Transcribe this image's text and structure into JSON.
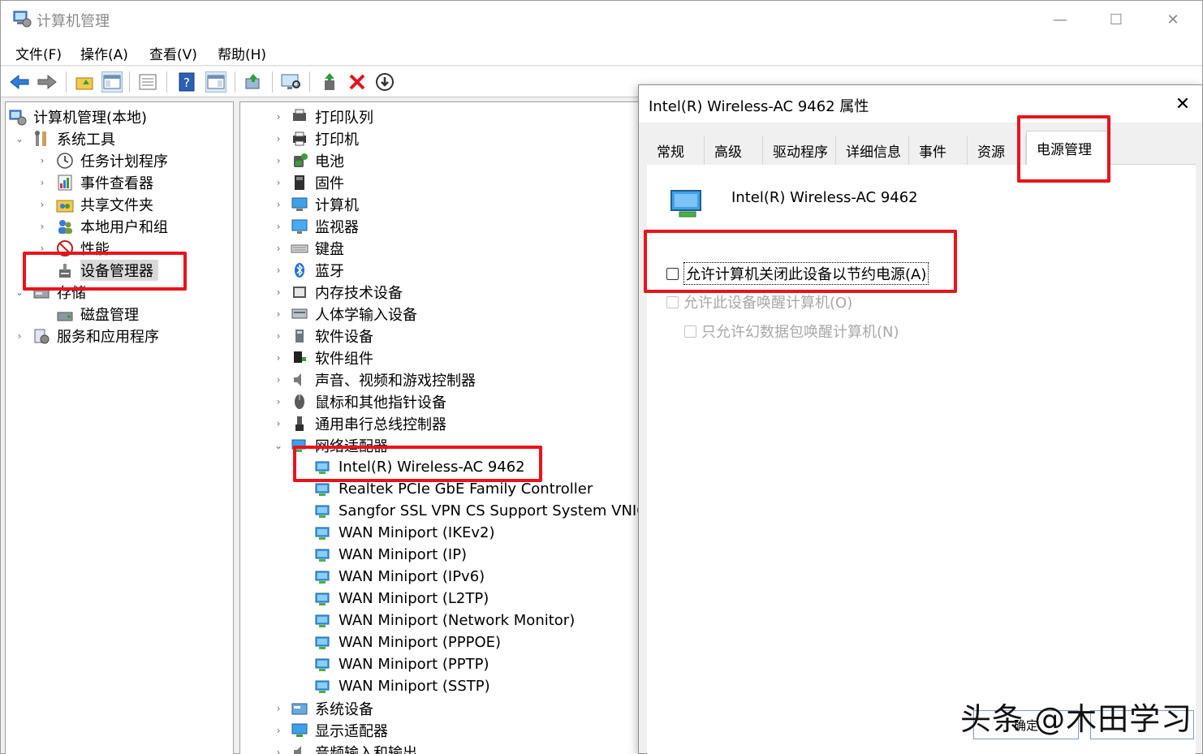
{
  "window": {
    "title": "计算机管理",
    "menu": [
      "文件(F)",
      "操作(A)",
      "查看(V)",
      "帮助(H)"
    ]
  },
  "left_tree": {
    "root": "计算机管理(本地)",
    "system_tools": "系统工具",
    "items": [
      "任务计划程序",
      "事件查看器",
      "共享文件夹",
      "本地用户和组",
      "性能",
      "设备管理器"
    ],
    "storage": "存储",
    "disk_mgmt": "磁盘管理",
    "services": "服务和应用程序"
  },
  "device_tree": {
    "categories_before": [
      "打印队列",
      "打印机",
      "电池",
      "固件",
      "计算机",
      "监视器",
      "键盘",
      "蓝牙",
      "内存技术设备",
      "人体学输入设备",
      "软件设备",
      "软件组件",
      "声音、视频和游戏控制器",
      "鼠标和其他指针设备",
      "通用串行总线控制器"
    ],
    "network_adapters": "网络适配器",
    "adapters": [
      "Intel(R) Wireless-AC 9462",
      "Realtek PCIe GbE Family Controller",
      "Sangfor SSL VPN CS Support System VNIC",
      "WAN Miniport (IKEv2)",
      "WAN Miniport (IP)",
      "WAN Miniport (IPv6)",
      "WAN Miniport (L2TP)",
      "WAN Miniport (Network Monitor)",
      "WAN Miniport (PPPOE)",
      "WAN Miniport (PPTP)",
      "WAN Miniport (SSTP)"
    ],
    "categories_after": [
      "系统设备",
      "显示适配器",
      "音频输入和输出"
    ]
  },
  "dialog": {
    "title": "Intel(R) Wireless-AC 9462 属性",
    "tabs": [
      "常规",
      "高级",
      "驱动程序",
      "详细信息",
      "事件",
      "资源",
      "电源管理"
    ],
    "active_tab": "电源管理",
    "device_name": "Intel(R) Wireless-AC 9462",
    "options": [
      {
        "label": "允许计算机关闭此设备以节约电源(A)",
        "checked": false,
        "enabled": true
      },
      {
        "label": "允许此设备唤醒计算机(O)",
        "checked": false,
        "enabled": false
      },
      {
        "label": "只允许幻数据包唤醒计算机(N)",
        "checked": false,
        "enabled": false
      }
    ],
    "ok_label": "确定"
  },
  "watermark": "头条 @木田学习",
  "colors": {
    "highlight": "#e8141b",
    "selection": "#d9d9d9"
  }
}
